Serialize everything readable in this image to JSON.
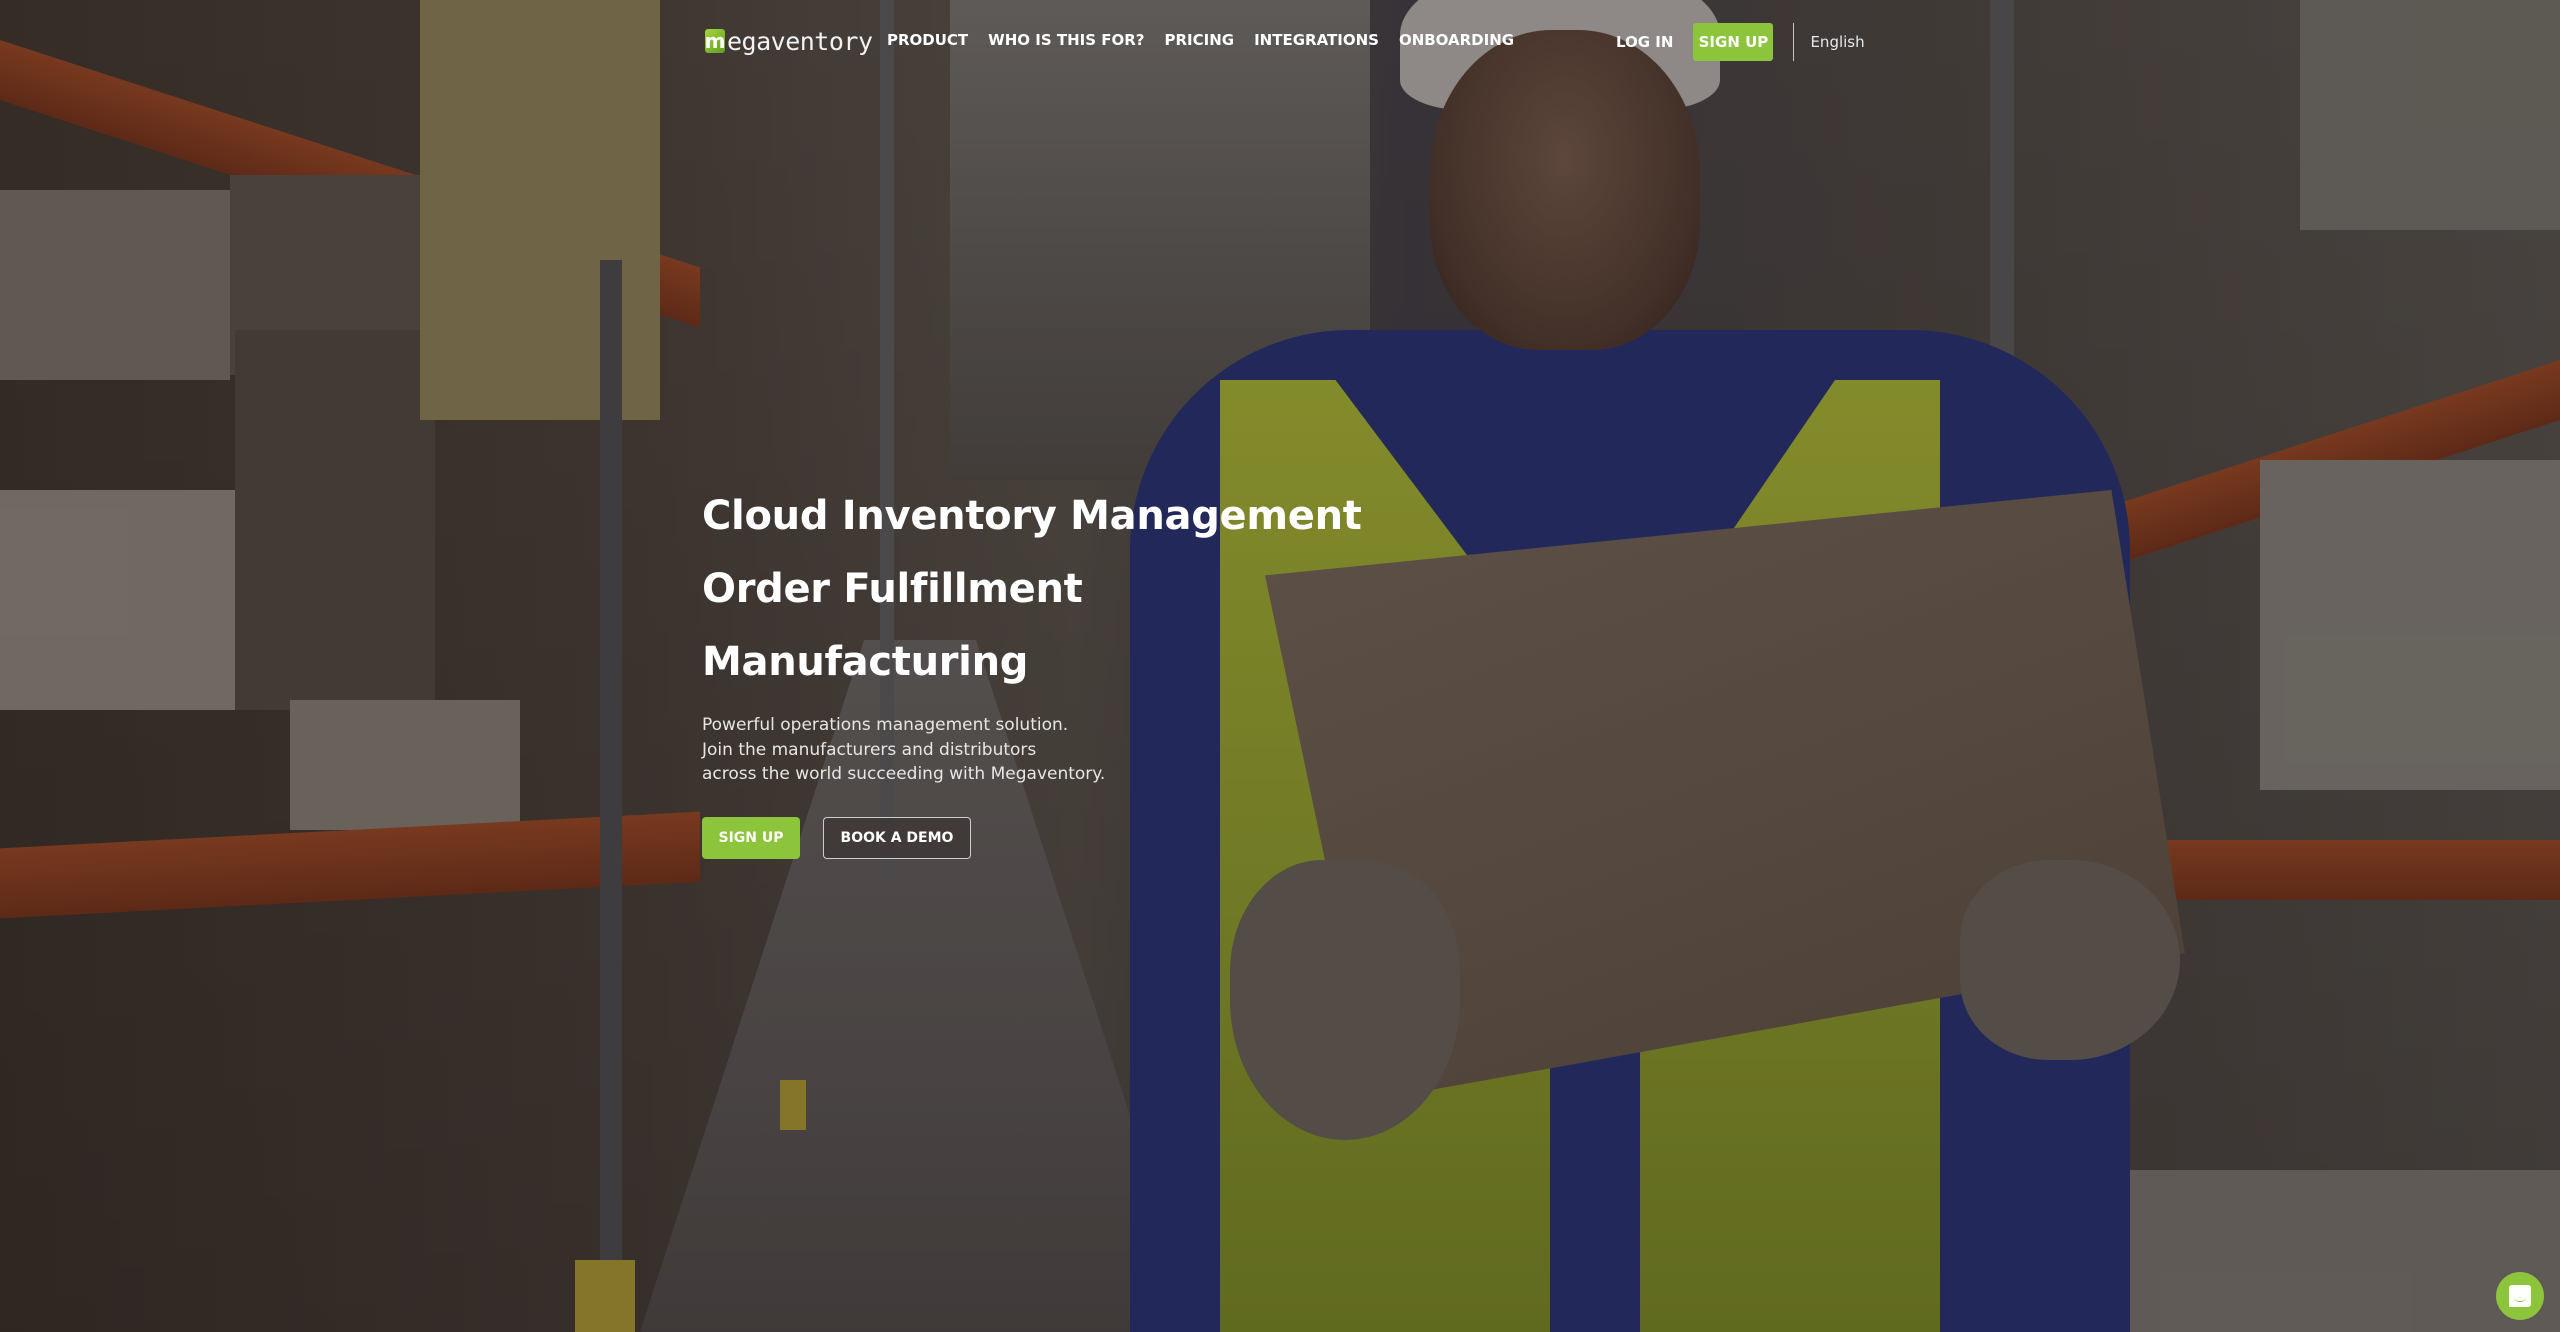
{
  "brand": {
    "name": "megaventory",
    "logo_letter": "m",
    "accent_color": "#8cc43c"
  },
  "nav": {
    "links": [
      {
        "label": "PRODUCT"
      },
      {
        "label": "WHO IS THIS FOR?"
      },
      {
        "label": "PRICING"
      },
      {
        "label": "INTEGRATIONS"
      },
      {
        "label": "ONBOARDING"
      }
    ],
    "login_label": "LOG IN",
    "signup_label": "SIGN UP",
    "language": "English"
  },
  "hero": {
    "headlines": [
      "Cloud Inventory Management",
      "Order Fulfillment",
      "Manufacturing"
    ],
    "description_lines": [
      "Powerful operations management solution.",
      "Join the manufacturers and distributors",
      "across the world succeeding with Megaventory."
    ],
    "primary_button": "SIGN UP",
    "secondary_button": "BOOK A DEMO"
  },
  "chat_widget": {
    "icon": "chat-bubble-icon"
  },
  "background": {
    "description": "warehouse worker carrying cardboard box in aisle"
  }
}
